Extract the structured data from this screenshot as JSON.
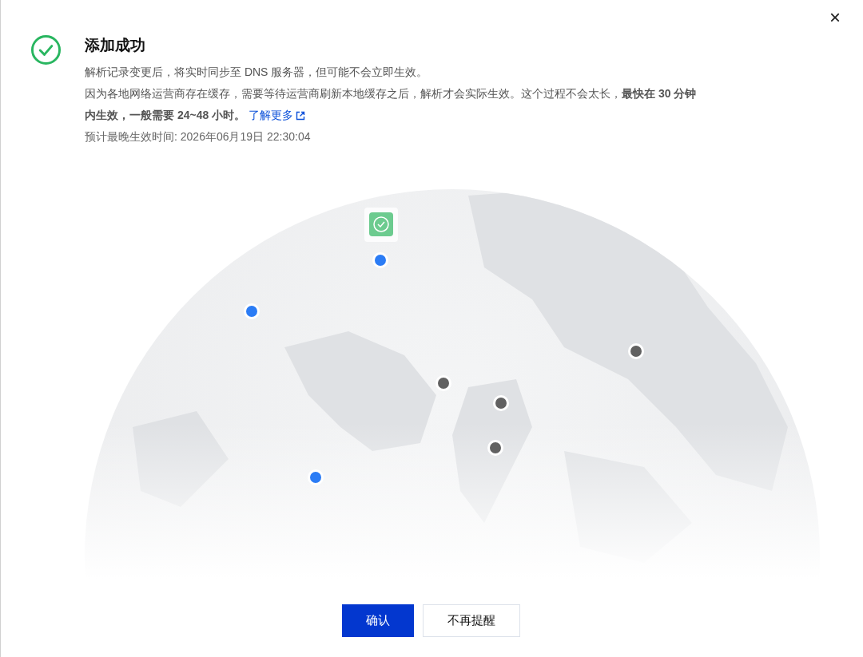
{
  "dialog": {
    "title": "添加成功",
    "close": "×",
    "lines": [
      "解析记录变更后，将实时同步至 DNS 服务器，但可能不会立即生效。"
    ],
    "notice": "因为各地网络运营商存在缓存，需要等待运营商刷新本地缓存之后，解析才会实际生效。这个过程不会太长，**最快在 30 分钟内生效，一般需要 24~48 小时。**",
    "link": "了解更多",
    "eta": "预计最晚生效时间: 2026年06月19日 22:30:04",
    "map_nodes": [
      {
        "color": "#2b7cf5"
      },
      {
        "color": "#2b7cf5"
      },
      {
        "color": "#616161"
      },
      {
        "color": "#616161"
      },
      {
        "color": "#616161"
      },
      {
        "color": "#616161"
      },
      {
        "color": "#2b7cf5"
      }
    ],
    "buttons": [
      {
        "label": "确认",
        "kind": "primary"
      },
      {
        "label": "不再提醒",
        "kind": "secondary"
      }
    ]
  }
}
